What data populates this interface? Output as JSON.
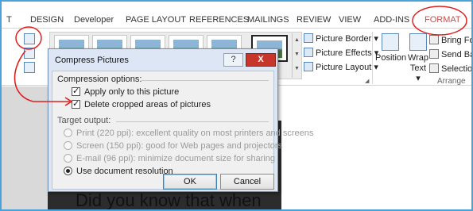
{
  "ribbon_tabs": [
    "T",
    "DESIGN",
    "Developer",
    "PAGE LAYOUT",
    "REFERENCES",
    "MAILINGS",
    "REVIEW",
    "VIEW",
    "ADD-INS",
    "FORMAT"
  ],
  "picture_commands": {
    "border": "Picture Border",
    "effects": "Picture Effects",
    "layout": "Picture Layout"
  },
  "arrange": {
    "position": "Position",
    "wrap_line1": "Wrap",
    "wrap_line2": "Text",
    "bring_forward": "Bring For",
    "send_backward": "Send Bac",
    "selection": "Selection",
    "group_label": "Arrange"
  },
  "dialog": {
    "title": "Compress Pictures",
    "help": "?",
    "close": "X",
    "compression_label": "Compression options:",
    "apply_only": "Apply only to this picture",
    "apply_only_checked": true,
    "delete_cropped": "Delete cropped areas of pictures",
    "delete_cropped_checked": true,
    "target_label": "Target output:",
    "outputs": [
      {
        "label": "Print (220 ppi): excellent quality on most printers and screens",
        "selected": false,
        "enabled": false
      },
      {
        "label": "Screen (150 ppi): good for Web pages and projectors",
        "selected": false,
        "enabled": false
      },
      {
        "label": "E-mail (96 ppi): minimize document size for sharing",
        "selected": false,
        "enabled": false
      },
      {
        "label": "Use document resolution",
        "selected": true,
        "enabled": true
      }
    ],
    "ok": "OK",
    "cancel": "Cancel"
  },
  "document": {
    "visible_text": "Did you know that when"
  },
  "colors": {
    "annotation_red": "#e02020",
    "frame_blue": "#4aa3d8",
    "format_tab": "#c0504d"
  }
}
